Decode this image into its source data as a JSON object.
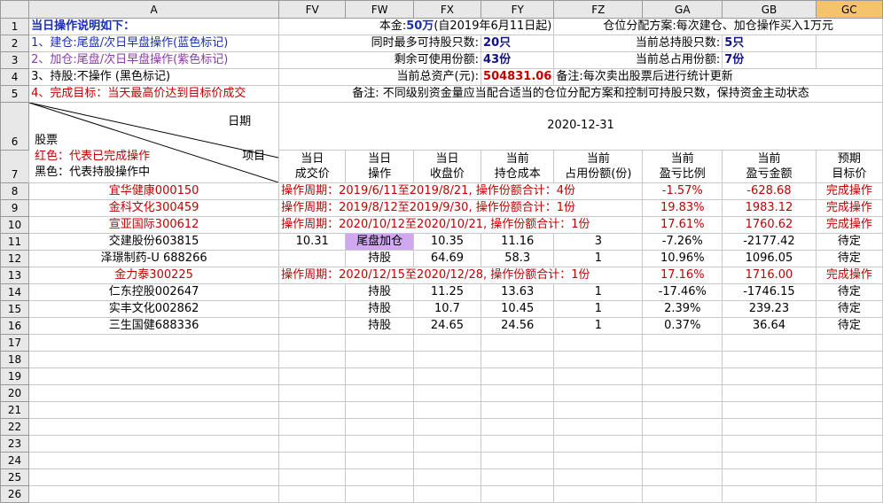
{
  "columns": [
    "A",
    "FV",
    "FW",
    "FX",
    "FY",
    "FZ",
    "GA",
    "GB",
    "GC"
  ],
  "info": {
    "title": "当日操作说明如下：",
    "rule1": "1、建仓:尾盘/次日早盘操作(蓝色标记)",
    "rule2": "2、加仓:尾盘/次日早盘操作(紫色标记)",
    "rule3": "3、持股:不操作 (黑色标记)",
    "rule4": "4、完成目标：当天最高价达到目标价成交",
    "capital_label": "本金:",
    "capital_value": "50万",
    "capital_since": "(自2019年6月11日起)",
    "alloc_plan": "仓位分配方案:每次建仓、加仓操作买入1万元",
    "max_hold_label": "同时最多可持股只数:",
    "max_hold_value": "20只",
    "cur_hold_label": "当前总持股只数:",
    "cur_hold_value": "5只",
    "remain_label": "剩余可使用份额:",
    "remain_value": "43份",
    "used_label": "当前总占用份额:",
    "used_value": "7份",
    "assets_label": "当前总资产(元):",
    "assets_value": "504831.06",
    "note1": "备注:每次卖出股票后进行统计更新",
    "note2": "备注: 不同级别资金量应当配合适当的仓位分配方案和控制可持股只数，保持资金主动状态"
  },
  "header": {
    "date_label": "日期",
    "stock_label": "股票",
    "item_label": "项目",
    "legend_red": "红色：代表已完成操作",
    "legend_black": "黑色：代表持股操作中",
    "date_value": "2020-12-31",
    "col_headers": [
      {
        "l1": "当日",
        "l2": "成交价"
      },
      {
        "l1": "当日",
        "l2": "操作"
      },
      {
        "l1": "当日",
        "l2": "收盘价"
      },
      {
        "l1": "当前",
        "l2": "持仓成本"
      },
      {
        "l1": "当前",
        "l2": "占用份额(份)"
      },
      {
        "l1": "当前",
        "l2": "盈亏比例"
      },
      {
        "l1": "当前",
        "l2": "盈亏金额"
      },
      {
        "l1": "预期",
        "l2": "目标价"
      }
    ]
  },
  "rows": [
    {
      "row": "8",
      "stock": "宜华健康000150",
      "status": "done",
      "period": "操作周期：2019/6/11至2019/8/21, 操作份额合计：4份",
      "ratio": "-1.57%",
      "amount": "-628.68",
      "target": "完成操作"
    },
    {
      "row": "9",
      "stock": "金科文化300459",
      "status": "done",
      "period": "操作周期：2019/8/12至2019/9/30, 操作份额合计：1份",
      "ratio": "19.83%",
      "amount": "1983.12",
      "target": "完成操作"
    },
    {
      "row": "10",
      "stock": "宣亚国际300612",
      "status": "done",
      "period": "操作周期：2020/10/12至2020/10/21, 操作份额合计：1份",
      "ratio": "17.61%",
      "amount": "1760.62",
      "target": "完成操作"
    },
    {
      "row": "11",
      "stock": "交建股份603815",
      "status": "hold",
      "deal": "10.31",
      "op": "尾盘加仓",
      "close": "10.35",
      "cost": "11.16",
      "share": "3",
      "ratio": "-7.26%",
      "amount": "-2177.42",
      "target": "待定"
    },
    {
      "row": "12",
      "stock": "泽璟制药-U 688266",
      "status": "hold",
      "deal": "",
      "op": "持股",
      "close": "64.69",
      "cost": "58.3",
      "share": "1",
      "ratio": "10.96%",
      "amount": "1096.05",
      "target": "待定"
    },
    {
      "row": "13",
      "stock": "金力泰300225",
      "status": "done",
      "period": "操作周期：2020/12/15至2020/12/28, 操作份额合计：1份",
      "ratio": "17.16%",
      "amount": "1716.00",
      "target": "完成操作"
    },
    {
      "row": "14",
      "stock": "仁东控股002647",
      "status": "hold",
      "deal": "",
      "op": "持股",
      "close": "11.25",
      "cost": "13.63",
      "share": "1",
      "ratio": "-17.46%",
      "amount": "-1746.15",
      "target": "待定"
    },
    {
      "row": "15",
      "stock": "实丰文化002862",
      "status": "hold",
      "deal": "",
      "op": "持股",
      "close": "10.7",
      "cost": "10.45",
      "share": "1",
      "ratio": "2.39%",
      "amount": "239.23",
      "target": "待定"
    },
    {
      "row": "16",
      "stock": "三生国健688336",
      "status": "hold",
      "deal": "",
      "op": "持股",
      "close": "24.65",
      "cost": "24.56",
      "share": "1",
      "ratio": "0.37%",
      "amount": "36.64",
      "target": "待定"
    }
  ],
  "empty_rows": [
    "17",
    "18",
    "19",
    "20",
    "21",
    "22",
    "23",
    "24",
    "25",
    "26"
  ],
  "row_numbers_top": [
    "1",
    "2",
    "3",
    "4",
    "5",
    "6",
    "7"
  ],
  "colors": {
    "red": "#c00000",
    "blue": "#1a2eb3",
    "purple": "#8a3aa8",
    "op_highlight": "#cfa8ef",
    "selected_col": "#f5c36b"
  }
}
